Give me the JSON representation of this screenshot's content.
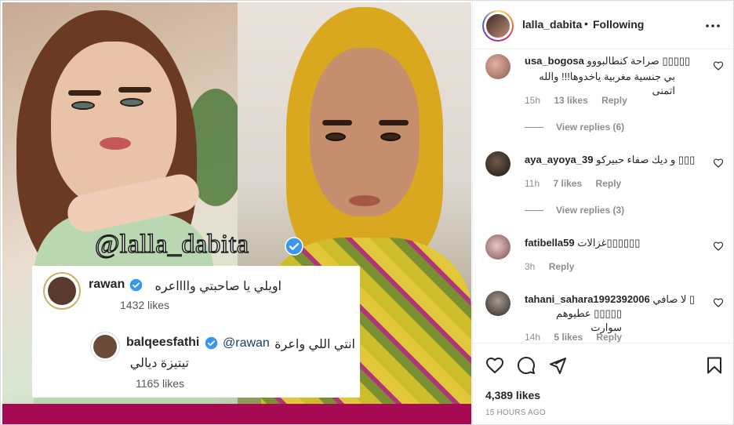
{
  "media": {
    "watermark": "@lalla_dabita",
    "card": {
      "comments": [
        {
          "username": "rawan",
          "text": "اويلي يا صاحبتي وااااعره",
          "likes": "1432 likes"
        },
        {
          "username": "balqeesfathi",
          "mention": "@rawan",
          "text_line1": "انتي اللي واعرة",
          "text_line2": "تيتيزة ديالي",
          "likes": "1165 likes"
        }
      ]
    }
  },
  "header": {
    "username": "lalla_dabita",
    "separator": "•",
    "follow_status": "Following"
  },
  "comments": [
    {
      "username": "usa_bogosa",
      "text_line1": "صراحة كنطالبووو ▯▯▯▯▯",
      "text_line2": "بي جنسية مغربية ياخدوها!!! والله اتمنى",
      "time": "15h",
      "likes": "13 likes",
      "reply": "Reply",
      "view_replies": "View replies (6)"
    },
    {
      "username": "aya_ayoya_39",
      "text_line1": "و ديك صفاء حبيركو ▯▯▯",
      "time": "11h",
      "likes": "7 likes",
      "reply": "Reply",
      "view_replies": "View replies (3)"
    },
    {
      "username": "fatibella59",
      "text_line1": "غزالات▯▯▯▯▯▯",
      "time": "3h",
      "reply": "Reply"
    },
    {
      "username": "tahani_sahara1992392006",
      "text_line1": "لا صافي ▯",
      "text_line2": "▯▯▯▯▯ عطيوهم سوارت",
      "time": "14h",
      "likes": "5 likes",
      "reply": "Reply"
    }
  ],
  "actions": {
    "likes": "4,389 likes",
    "timestamp": "15 HOURS AGO"
  },
  "icons": {
    "verified": "verified-badge-icon",
    "more": "more-options-icon",
    "like": "heart-icon",
    "comment": "comment-icon",
    "share": "share-icon",
    "save": "bookmark-icon"
  },
  "colors": {
    "verified": "#3897f0",
    "band": "#a50a52",
    "secondary_text": "#8e8e8e"
  }
}
